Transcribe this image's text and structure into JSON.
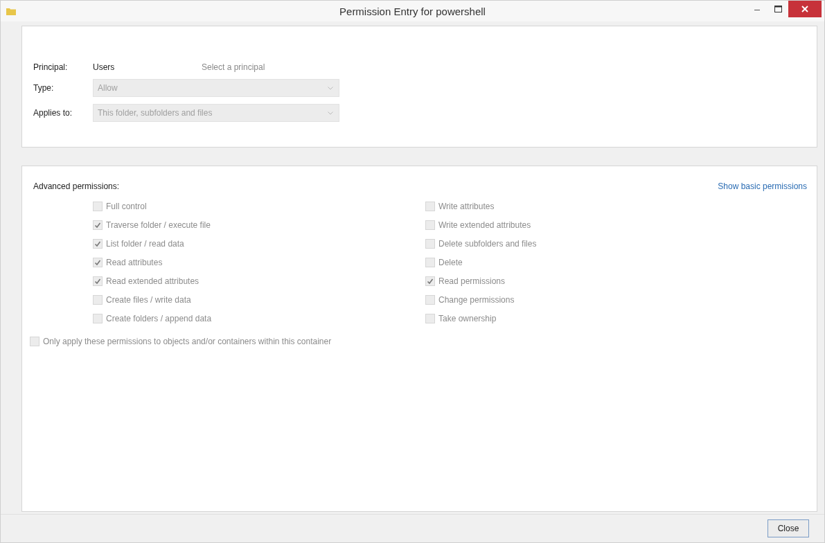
{
  "window": {
    "title": "Permission Entry for powershell"
  },
  "principal": {
    "label": "Principal:",
    "value": "Users",
    "link": "Select a principal"
  },
  "fields": [
    {
      "label": "Type:",
      "value": "Allow",
      "disabled": true
    },
    {
      "label": "Applies to:",
      "value": "This folder, subfolders and files",
      "disabled": true
    }
  ],
  "permissions": {
    "title": "Advanced permissions:",
    "toggle_link": "Show basic permissions",
    "columns": [
      [
        {
          "label": "Full control",
          "checked": false,
          "disabled": true
        },
        {
          "label": "Traverse folder / execute file",
          "checked": true,
          "disabled": true
        },
        {
          "label": "List folder / read data",
          "checked": true,
          "disabled": true
        },
        {
          "label": "Read attributes",
          "checked": true,
          "disabled": true
        },
        {
          "label": "Read extended attributes",
          "checked": true,
          "disabled": true
        },
        {
          "label": "Create files / write data",
          "checked": false,
          "disabled": true
        },
        {
          "label": "Create folders / append data",
          "checked": false,
          "disabled": true
        }
      ],
      [
        {
          "label": "Write attributes",
          "checked": false,
          "disabled": true
        },
        {
          "label": "Write extended attributes",
          "checked": false,
          "disabled": true
        },
        {
          "label": "Delete subfolders and files",
          "checked": false,
          "disabled": true
        },
        {
          "label": "Delete",
          "checked": false,
          "disabled": true
        },
        {
          "label": "Read permissions",
          "checked": true,
          "disabled": true
        },
        {
          "label": "Change permissions",
          "checked": false,
          "disabled": true
        },
        {
          "label": "Take ownership",
          "checked": false,
          "disabled": true
        }
      ]
    ],
    "only_apply": {
      "label": "Only apply these permissions to objects and/or containers within this container",
      "checked": false,
      "disabled": true
    }
  },
  "buttons": [
    "Close"
  ]
}
